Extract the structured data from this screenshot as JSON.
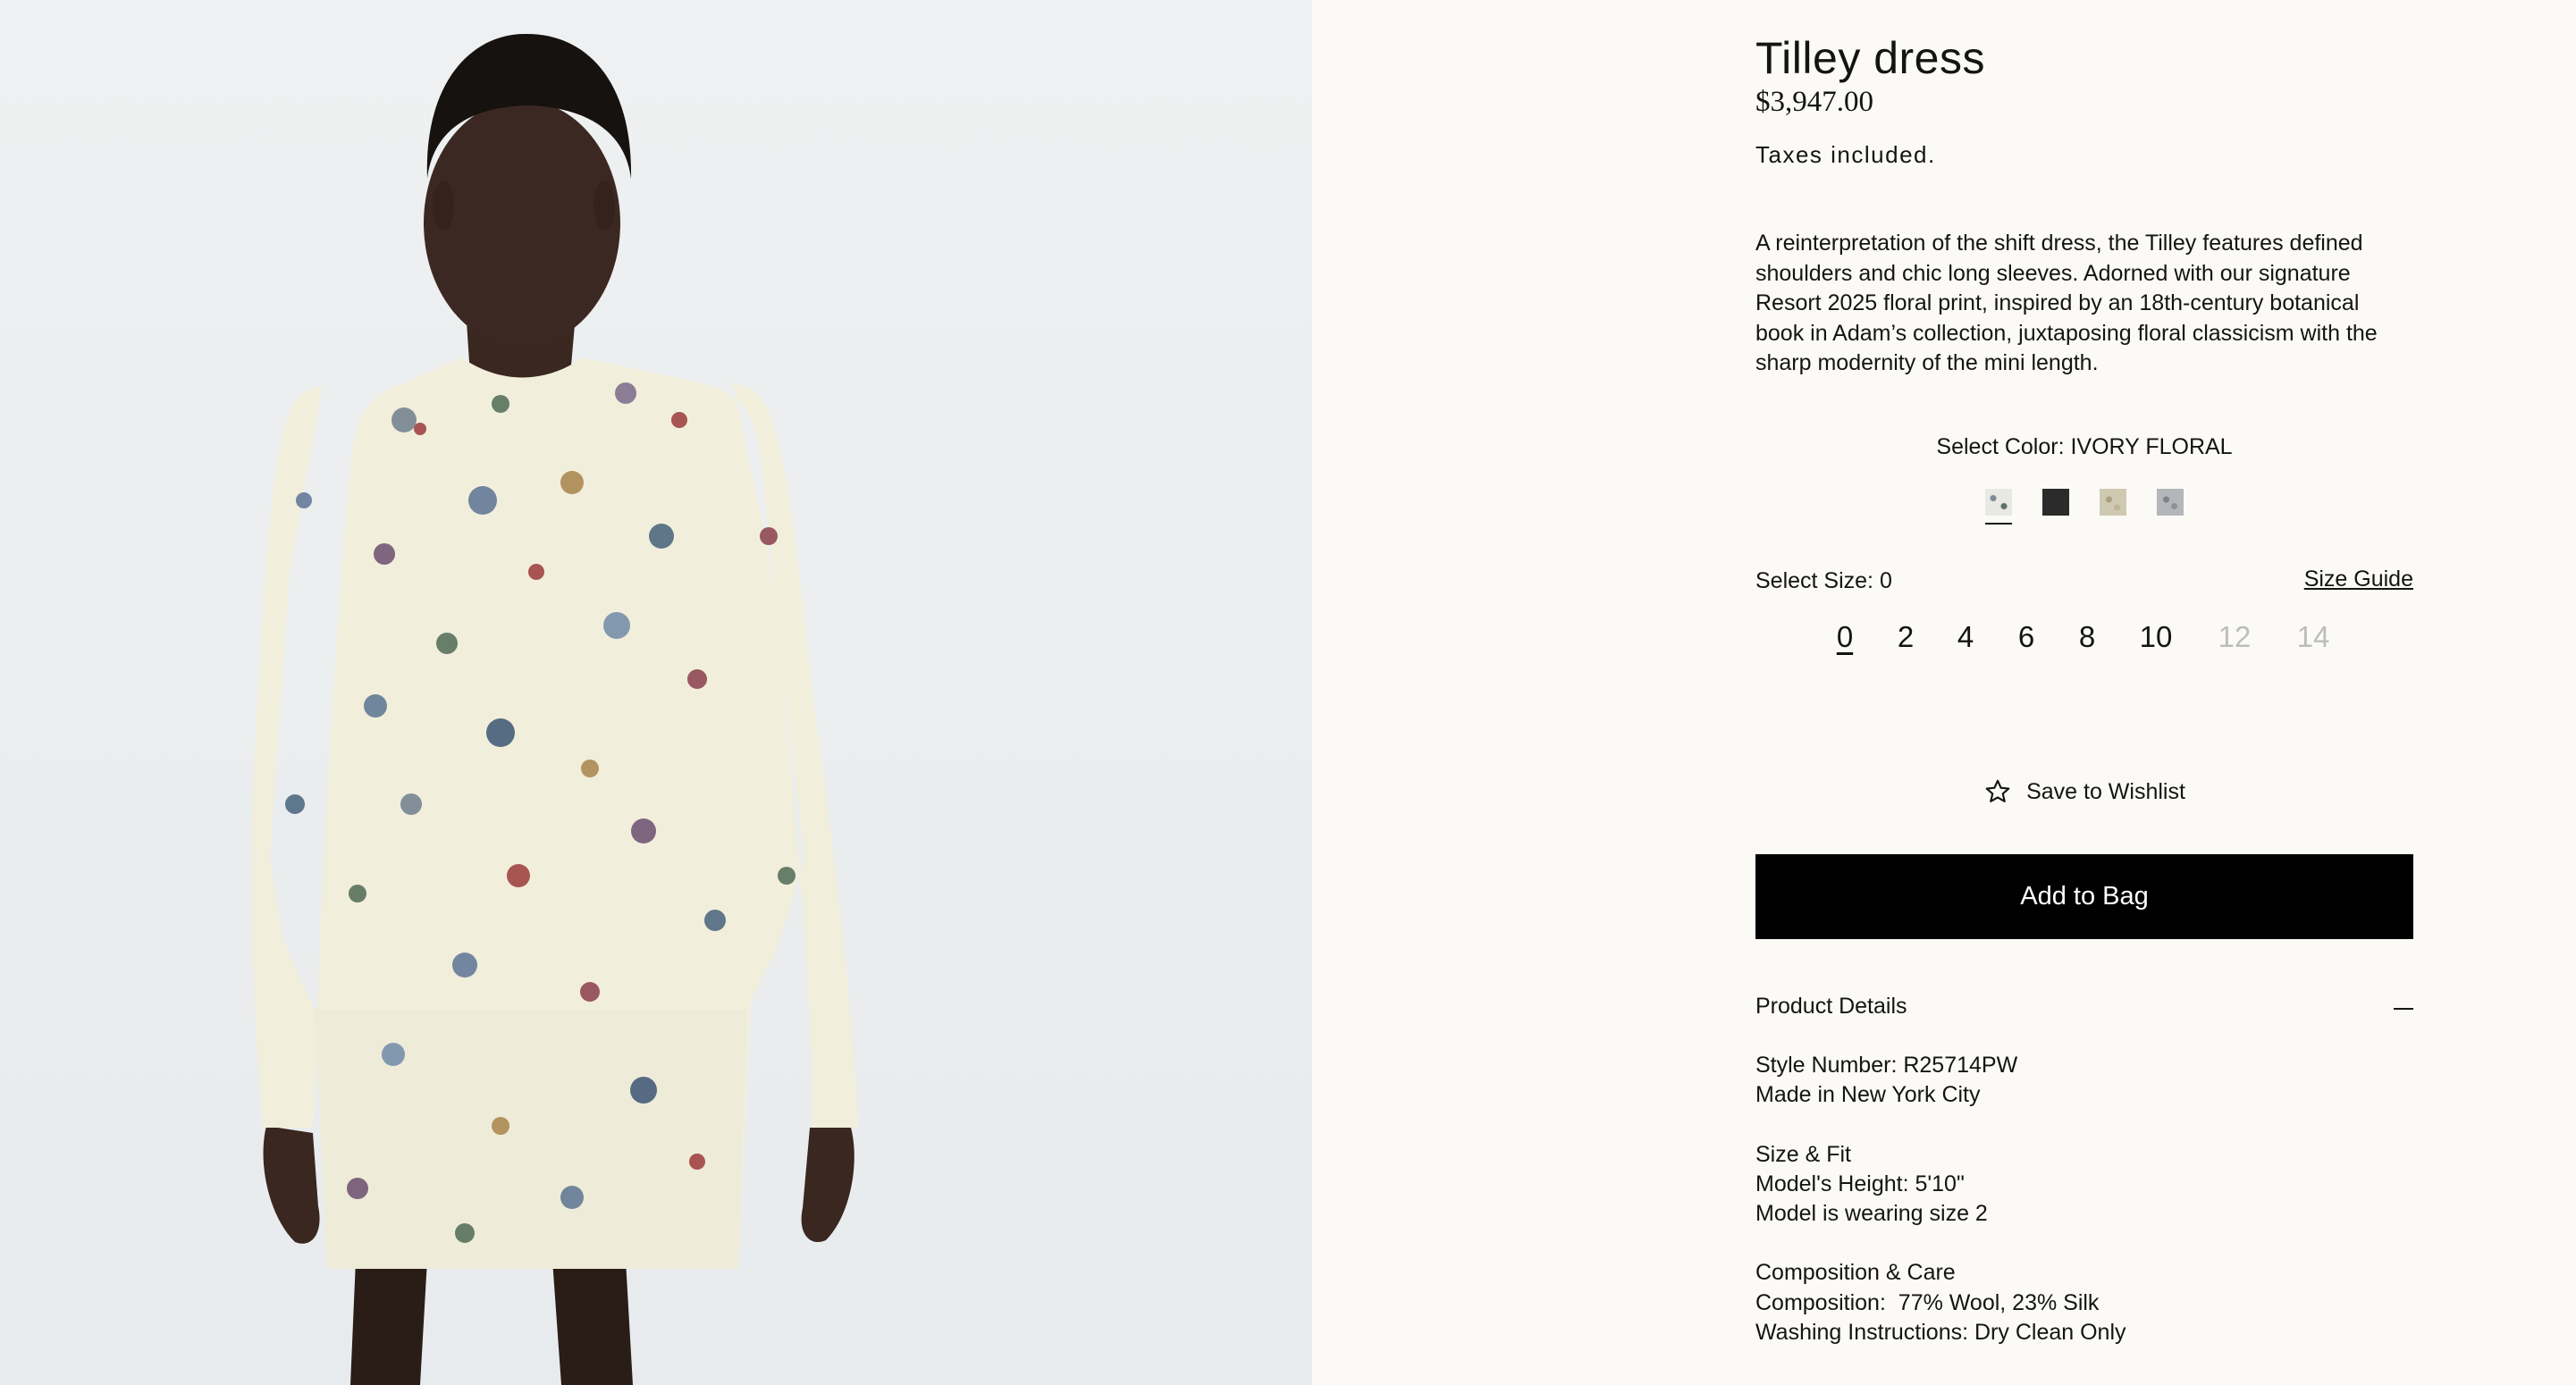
{
  "product": {
    "title": "Tilley dress",
    "price": "$3,947.00",
    "tax_note": "Taxes included.",
    "description": "A reinterpretation of the shift dress, the Tilley features defined shoulders and chic long sleeves. Adorned with our signature Resort 2025 floral print, inspired by an 18th-century botanical book in Adam’s collection, juxtaposing floral classicism with the sharp modernity of the mini length."
  },
  "color": {
    "label": "Select Color: IVORY FLORAL",
    "swatches": [
      {
        "name": "ivory-floral",
        "fill": "#e9e9e4",
        "selected": true
      },
      {
        "name": "black",
        "fill": "#2b2b2b",
        "selected": false
      },
      {
        "name": "khaki-floral",
        "fill": "#cfc9b2",
        "selected": false
      },
      {
        "name": "grey-floral",
        "fill": "#b4b6bb",
        "selected": false
      }
    ]
  },
  "size": {
    "label": "Select Size: 0",
    "guide_label": "Size Guide",
    "options": [
      {
        "label": "0",
        "selected": true,
        "available": true
      },
      {
        "label": "2",
        "selected": false,
        "available": true
      },
      {
        "label": "4",
        "selected": false,
        "available": true
      },
      {
        "label": "6",
        "selected": false,
        "available": true
      },
      {
        "label": "8",
        "selected": false,
        "available": true
      },
      {
        "label": "10",
        "selected": false,
        "available": true
      },
      {
        "label": "12",
        "selected": false,
        "available": false
      },
      {
        "label": "14",
        "selected": false,
        "available": false
      }
    ]
  },
  "actions": {
    "wishlist_label": "Save to Wishlist",
    "add_to_bag_label": "Add to Bag"
  },
  "details": {
    "title": "Product Details",
    "style_number": "Style Number: R25714PW",
    "made_in": "Made in New York City",
    "size_fit_heading": "Size & Fit",
    "model_height": "Model's Height: 5'10\"",
    "model_size": "Model is wearing size 2",
    "composition_heading": "Composition & Care",
    "composition": "Composition:  77% Wool, 23% Silk",
    "washing": "Washing Instructions: Dry Clean Only"
  },
  "colors": {
    "page_bg": "#fbfaf6",
    "button_bg": "#000000",
    "button_text": "#ffffff",
    "disabled_size": "#bdbdbd",
    "image_bg": "#eceff0"
  }
}
